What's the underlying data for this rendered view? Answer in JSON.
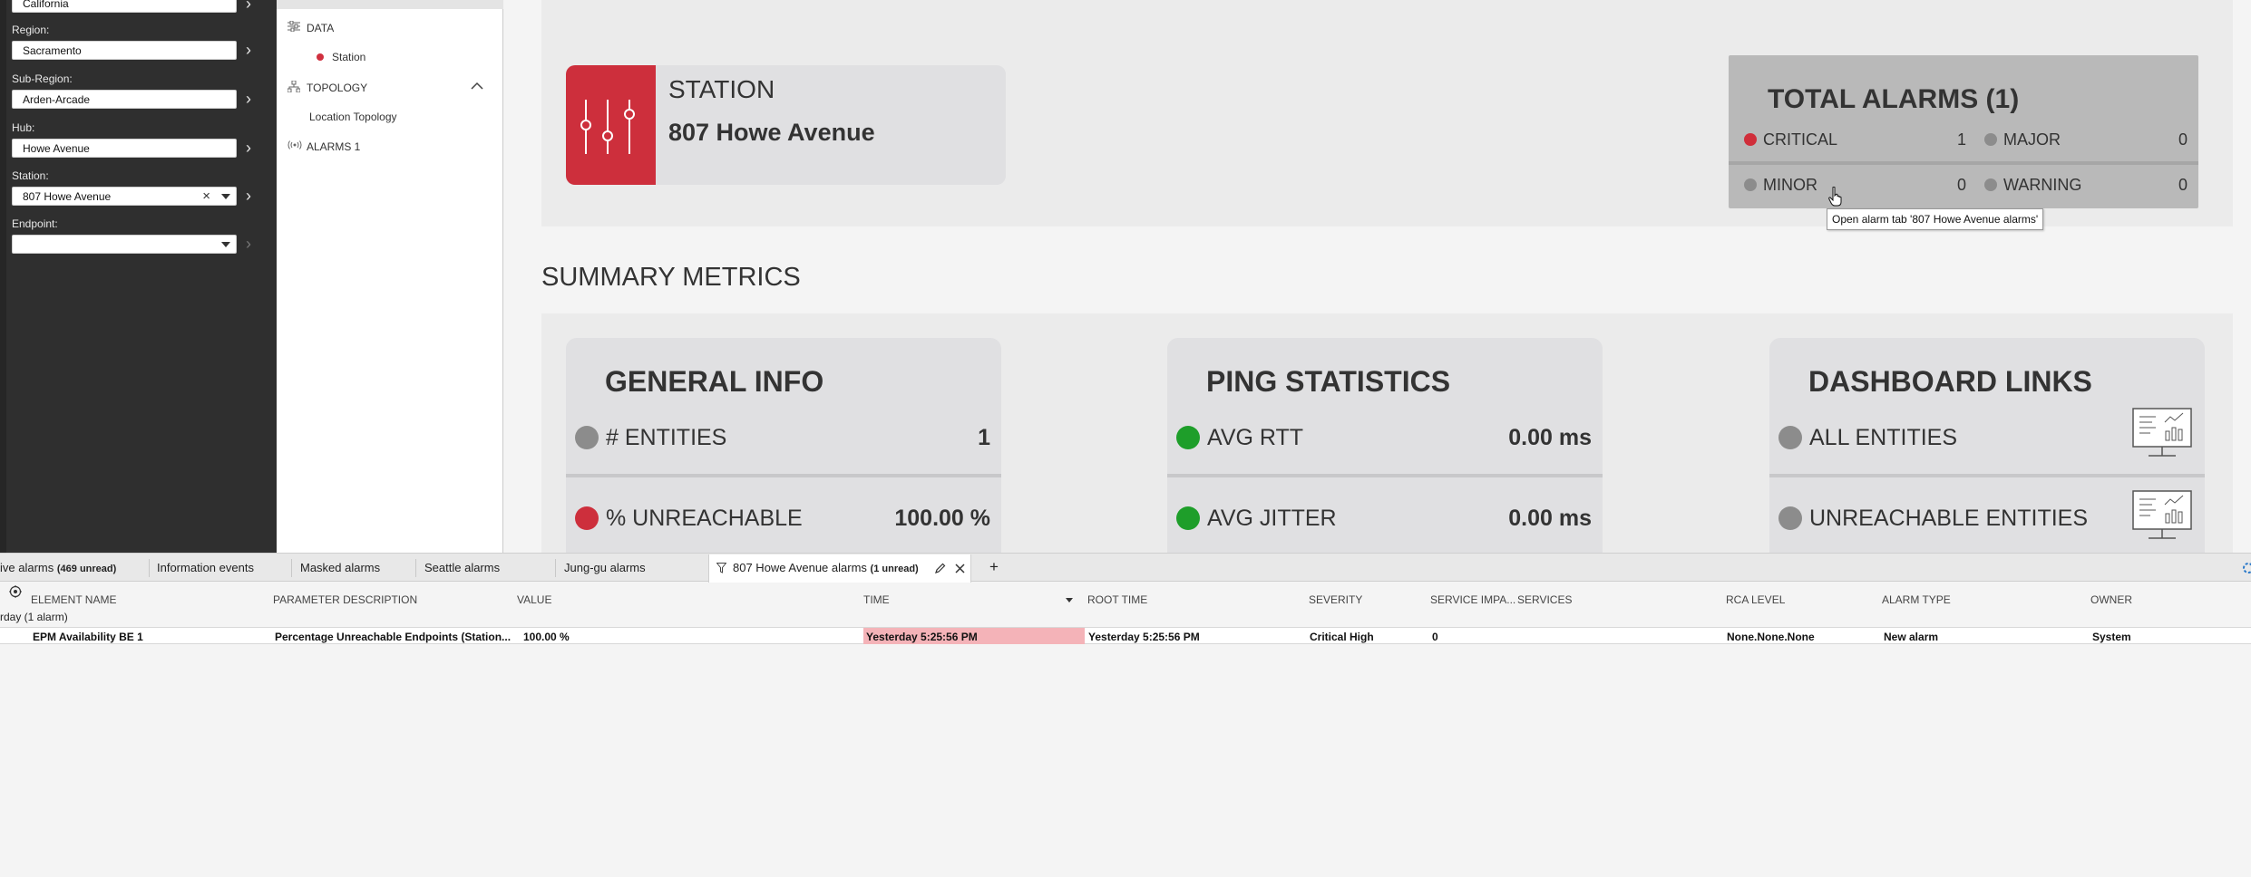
{
  "filters": {
    "top_value": "California",
    "region_label": "Region:",
    "region_value": "Sacramento",
    "subregion_label": "Sub-Region:",
    "subregion_value": "Arden-Arcade",
    "hub_label": "Hub:",
    "hub_value": "Howe Avenue",
    "station_label": "Station:",
    "station_value": "807 Howe Avenue",
    "endpoint_label": "Endpoint:",
    "endpoint_value": ""
  },
  "tree": {
    "data_label": "DATA",
    "station_label": "Station",
    "topology_label": "TOPOLOGY",
    "location_topology_label": "Location Topology",
    "alarms_label": "ALARMS 1"
  },
  "station": {
    "type": "STATION",
    "name": "807 Howe Avenue"
  },
  "alarms": {
    "title": "TOTAL ALARMS (1)",
    "critical_label": "CRITICAL",
    "critical_value": "1",
    "major_label": "MAJOR",
    "major_value": "0",
    "minor_label": "MINOR",
    "minor_value": "0",
    "warning_label": "WARNING",
    "warning_value": "0",
    "tooltip": "Open alarm tab '807 Howe Avenue alarms'"
  },
  "summary": {
    "title": "SUMMARY METRICS",
    "general": {
      "title": "GENERAL INFO",
      "row1_label": "# ENTITIES",
      "row1_value": "1",
      "row2_label": "% UNREACHABLE",
      "row2_value": "100.00 %"
    },
    "ping": {
      "title": "PING STATISTICS",
      "row1_label": "AVG RTT",
      "row1_value": "0.00 ms",
      "row2_label": "AVG JITTER",
      "row2_value": "0.00 ms"
    },
    "links": {
      "title": "DASHBOARD LINKS",
      "row1_label": "ALL ENTITIES",
      "row2_label": "UNREACHABLE ENTITIES"
    }
  },
  "colors": {
    "critical": "#cd2f3c",
    "ok": "#1e9e2a",
    "neutral": "#8c8c8c"
  },
  "bottom_tabs": {
    "tab1_label": "ive alarms",
    "tab1_sub": "(469 unread)",
    "tab2_label": "Information events",
    "tab3_label": "Masked alarms",
    "tab4_label": "Seattle alarms",
    "tab5_label": "Jung-gu alarms",
    "active_label": "807 Howe Avenue alarms",
    "active_sub": "(1 unread)",
    "add_label": "+"
  },
  "table": {
    "headers": {
      "element": "ELEMENT NAME",
      "param": "PARAMETER DESCRIPTION",
      "value": "VALUE",
      "time": "TIME",
      "root_time": "ROOT TIME",
      "severity": "SEVERITY",
      "service_impact": "SERVICE IMPA...",
      "services": "SERVICES",
      "rca": "RCA LEVEL",
      "alarm_type": "ALARM TYPE",
      "owner": "OWNER"
    },
    "group_label": "rday (1 alarm)",
    "row": {
      "element": "EPM Availability BE 1",
      "param": "Percentage Unreachable Endpoints (Station...",
      "value": "100.00 %",
      "time": "Yesterday 5:25:56 PM",
      "root_time": "Yesterday 5:25:56 PM",
      "severity": "Critical High",
      "service_impact": "0",
      "services": "",
      "rca": "None.None.None",
      "alarm_type": "New alarm",
      "owner": "System"
    }
  }
}
